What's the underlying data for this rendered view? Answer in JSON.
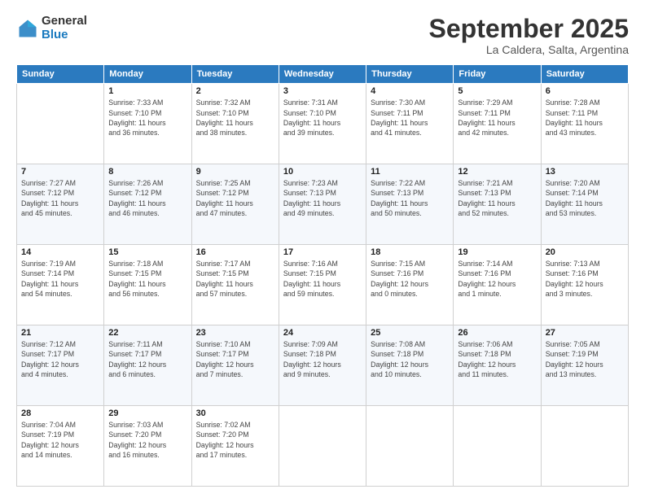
{
  "logo": {
    "general": "General",
    "blue": "Blue"
  },
  "header": {
    "month": "September 2025",
    "location": "La Caldera, Salta, Argentina"
  },
  "weekdays": [
    "Sunday",
    "Monday",
    "Tuesday",
    "Wednesday",
    "Thursday",
    "Friday",
    "Saturday"
  ],
  "weeks": [
    [
      {
        "day": "",
        "info": ""
      },
      {
        "day": "1",
        "info": "Sunrise: 7:33 AM\nSunset: 7:10 PM\nDaylight: 11 hours\nand 36 minutes."
      },
      {
        "day": "2",
        "info": "Sunrise: 7:32 AM\nSunset: 7:10 PM\nDaylight: 11 hours\nand 38 minutes."
      },
      {
        "day": "3",
        "info": "Sunrise: 7:31 AM\nSunset: 7:10 PM\nDaylight: 11 hours\nand 39 minutes."
      },
      {
        "day": "4",
        "info": "Sunrise: 7:30 AM\nSunset: 7:11 PM\nDaylight: 11 hours\nand 41 minutes."
      },
      {
        "day": "5",
        "info": "Sunrise: 7:29 AM\nSunset: 7:11 PM\nDaylight: 11 hours\nand 42 minutes."
      },
      {
        "day": "6",
        "info": "Sunrise: 7:28 AM\nSunset: 7:11 PM\nDaylight: 11 hours\nand 43 minutes."
      }
    ],
    [
      {
        "day": "7",
        "info": "Sunrise: 7:27 AM\nSunset: 7:12 PM\nDaylight: 11 hours\nand 45 minutes."
      },
      {
        "day": "8",
        "info": "Sunrise: 7:26 AM\nSunset: 7:12 PM\nDaylight: 11 hours\nand 46 minutes."
      },
      {
        "day": "9",
        "info": "Sunrise: 7:25 AM\nSunset: 7:12 PM\nDaylight: 11 hours\nand 47 minutes."
      },
      {
        "day": "10",
        "info": "Sunrise: 7:23 AM\nSunset: 7:13 PM\nDaylight: 11 hours\nand 49 minutes."
      },
      {
        "day": "11",
        "info": "Sunrise: 7:22 AM\nSunset: 7:13 PM\nDaylight: 11 hours\nand 50 minutes."
      },
      {
        "day": "12",
        "info": "Sunrise: 7:21 AM\nSunset: 7:13 PM\nDaylight: 11 hours\nand 52 minutes."
      },
      {
        "day": "13",
        "info": "Sunrise: 7:20 AM\nSunset: 7:14 PM\nDaylight: 11 hours\nand 53 minutes."
      }
    ],
    [
      {
        "day": "14",
        "info": "Sunrise: 7:19 AM\nSunset: 7:14 PM\nDaylight: 11 hours\nand 54 minutes."
      },
      {
        "day": "15",
        "info": "Sunrise: 7:18 AM\nSunset: 7:15 PM\nDaylight: 11 hours\nand 56 minutes."
      },
      {
        "day": "16",
        "info": "Sunrise: 7:17 AM\nSunset: 7:15 PM\nDaylight: 11 hours\nand 57 minutes."
      },
      {
        "day": "17",
        "info": "Sunrise: 7:16 AM\nSunset: 7:15 PM\nDaylight: 11 hours\nand 59 minutes."
      },
      {
        "day": "18",
        "info": "Sunrise: 7:15 AM\nSunset: 7:16 PM\nDaylight: 12 hours\nand 0 minutes."
      },
      {
        "day": "19",
        "info": "Sunrise: 7:14 AM\nSunset: 7:16 PM\nDaylight: 12 hours\nand 1 minute."
      },
      {
        "day": "20",
        "info": "Sunrise: 7:13 AM\nSunset: 7:16 PM\nDaylight: 12 hours\nand 3 minutes."
      }
    ],
    [
      {
        "day": "21",
        "info": "Sunrise: 7:12 AM\nSunset: 7:17 PM\nDaylight: 12 hours\nand 4 minutes."
      },
      {
        "day": "22",
        "info": "Sunrise: 7:11 AM\nSunset: 7:17 PM\nDaylight: 12 hours\nand 6 minutes."
      },
      {
        "day": "23",
        "info": "Sunrise: 7:10 AM\nSunset: 7:17 PM\nDaylight: 12 hours\nand 7 minutes."
      },
      {
        "day": "24",
        "info": "Sunrise: 7:09 AM\nSunset: 7:18 PM\nDaylight: 12 hours\nand 9 minutes."
      },
      {
        "day": "25",
        "info": "Sunrise: 7:08 AM\nSunset: 7:18 PM\nDaylight: 12 hours\nand 10 minutes."
      },
      {
        "day": "26",
        "info": "Sunrise: 7:06 AM\nSunset: 7:18 PM\nDaylight: 12 hours\nand 11 minutes."
      },
      {
        "day": "27",
        "info": "Sunrise: 7:05 AM\nSunset: 7:19 PM\nDaylight: 12 hours\nand 13 minutes."
      }
    ],
    [
      {
        "day": "28",
        "info": "Sunrise: 7:04 AM\nSunset: 7:19 PM\nDaylight: 12 hours\nand 14 minutes."
      },
      {
        "day": "29",
        "info": "Sunrise: 7:03 AM\nSunset: 7:20 PM\nDaylight: 12 hours\nand 16 minutes."
      },
      {
        "day": "30",
        "info": "Sunrise: 7:02 AM\nSunset: 7:20 PM\nDaylight: 12 hours\nand 17 minutes."
      },
      {
        "day": "",
        "info": ""
      },
      {
        "day": "",
        "info": ""
      },
      {
        "day": "",
        "info": ""
      },
      {
        "day": "",
        "info": ""
      }
    ]
  ]
}
